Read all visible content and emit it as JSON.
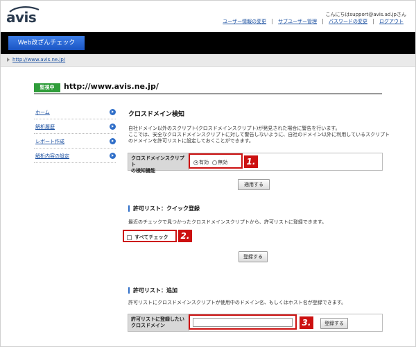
{
  "header": {
    "logo_text": "avis",
    "greeting": "こんにちはsupport@avis.ad.jpさん",
    "links": [
      "ユーザー情報の変更",
      "サブユーザー管理",
      "パスワードの変更",
      "ログアウト"
    ]
  },
  "nav": {
    "tab_label": "Web改ざんチェック"
  },
  "breadcrumb": {
    "link": "http://www.avis.ne.jp/"
  },
  "monitor": {
    "badge": "監視中",
    "url": "http://www.avis.ne.jp/"
  },
  "sidebar": {
    "items": [
      {
        "label": "ホーム"
      },
      {
        "label": "解析履歴"
      },
      {
        "label": "レポート作成"
      },
      {
        "label": "解析内容の設定"
      }
    ]
  },
  "main": {
    "title": "クロスドメイン検知",
    "desc_lines": [
      "自社ドメイン以外のスクリプト(クロスドメインスクリプト)が発見された場合に警告を行います。",
      "ここでは、安全なクロスドメインスクリプトに対して警告しないように、自社のドメイン以外に利用しているスクリプト",
      "のドメインを許可リストに設定しておくことができます。"
    ],
    "detect_label_line1": "クロスドメインスクリプト",
    "detect_label_line2": "の検知機能",
    "radio_on_label": "有効",
    "radio_off_label": "無効",
    "apply_button": "適用する",
    "marker1": "1.",
    "quick": {
      "title": "許可リスト：クイック登録",
      "desc": "最近のチェックで見つかったクロスドメインスクリプトから、許可リストに登録できます。",
      "check_all_label": "すべてチェック",
      "register_button": "登録する",
      "marker": "2."
    },
    "add": {
      "title": "許可リスト：追加",
      "desc": "許可リストにクロスドメインスクリプトが使用中のドメイン名、もしくはホスト名が登録できます。",
      "label_line1": "許可リストに登録したい",
      "label_line2": "クロスドメイン",
      "input_value": "",
      "register_button": "登録する",
      "marker": "3."
    }
  }
}
